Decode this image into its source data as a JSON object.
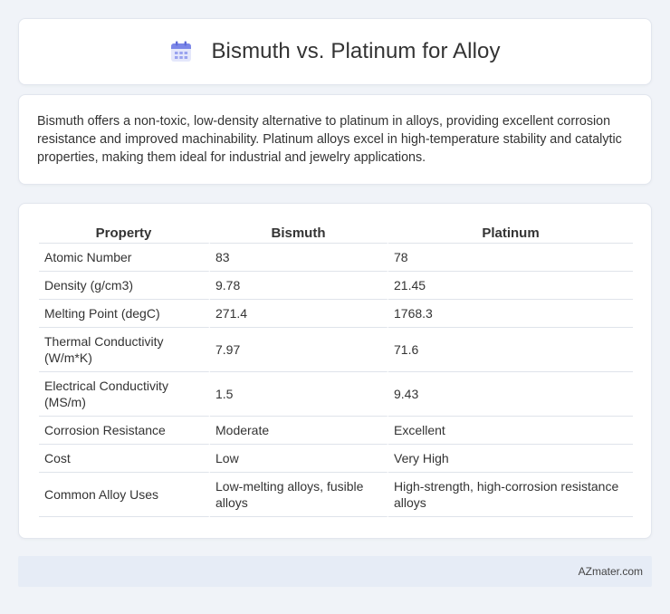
{
  "header": {
    "icon": "calendar-icon",
    "title": "Bismuth vs. Platinum for Alloy"
  },
  "summary": {
    "text": "Bismuth offers a non-toxic, low-density alternative to platinum in alloys, providing excellent corrosion resistance and improved machinability. Platinum alloys excel in high-temperature stability and catalytic properties, making them ideal for industrial and jewelry applications."
  },
  "table": {
    "headers": [
      "Property",
      "Bismuth",
      "Platinum"
    ],
    "rows": [
      [
        "Atomic Number",
        "83",
        "78"
      ],
      [
        "Density (g/cm3)",
        "9.78",
        "21.45"
      ],
      [
        "Melting Point (degC)",
        "271.4",
        "1768.3"
      ],
      [
        "Thermal Conductivity (W/m*K)",
        "7.97",
        "71.6"
      ],
      [
        "Electrical Conductivity (MS/m)",
        "1.5",
        "9.43"
      ],
      [
        "Corrosion Resistance",
        "Moderate",
        "Excellent"
      ],
      [
        "Cost",
        "Low",
        "Very High"
      ],
      [
        "Common Alloy Uses",
        "Low-melting alloys, fusible alloys",
        "High-strength, high-corrosion resistance alloys"
      ]
    ]
  },
  "footer": {
    "text": "AZmater.com"
  },
  "colors": {
    "background": "#f0f3f8",
    "card": "#ffffff",
    "footer_bar": "#e6ecf6",
    "icon_accent": "#7b86e8"
  }
}
